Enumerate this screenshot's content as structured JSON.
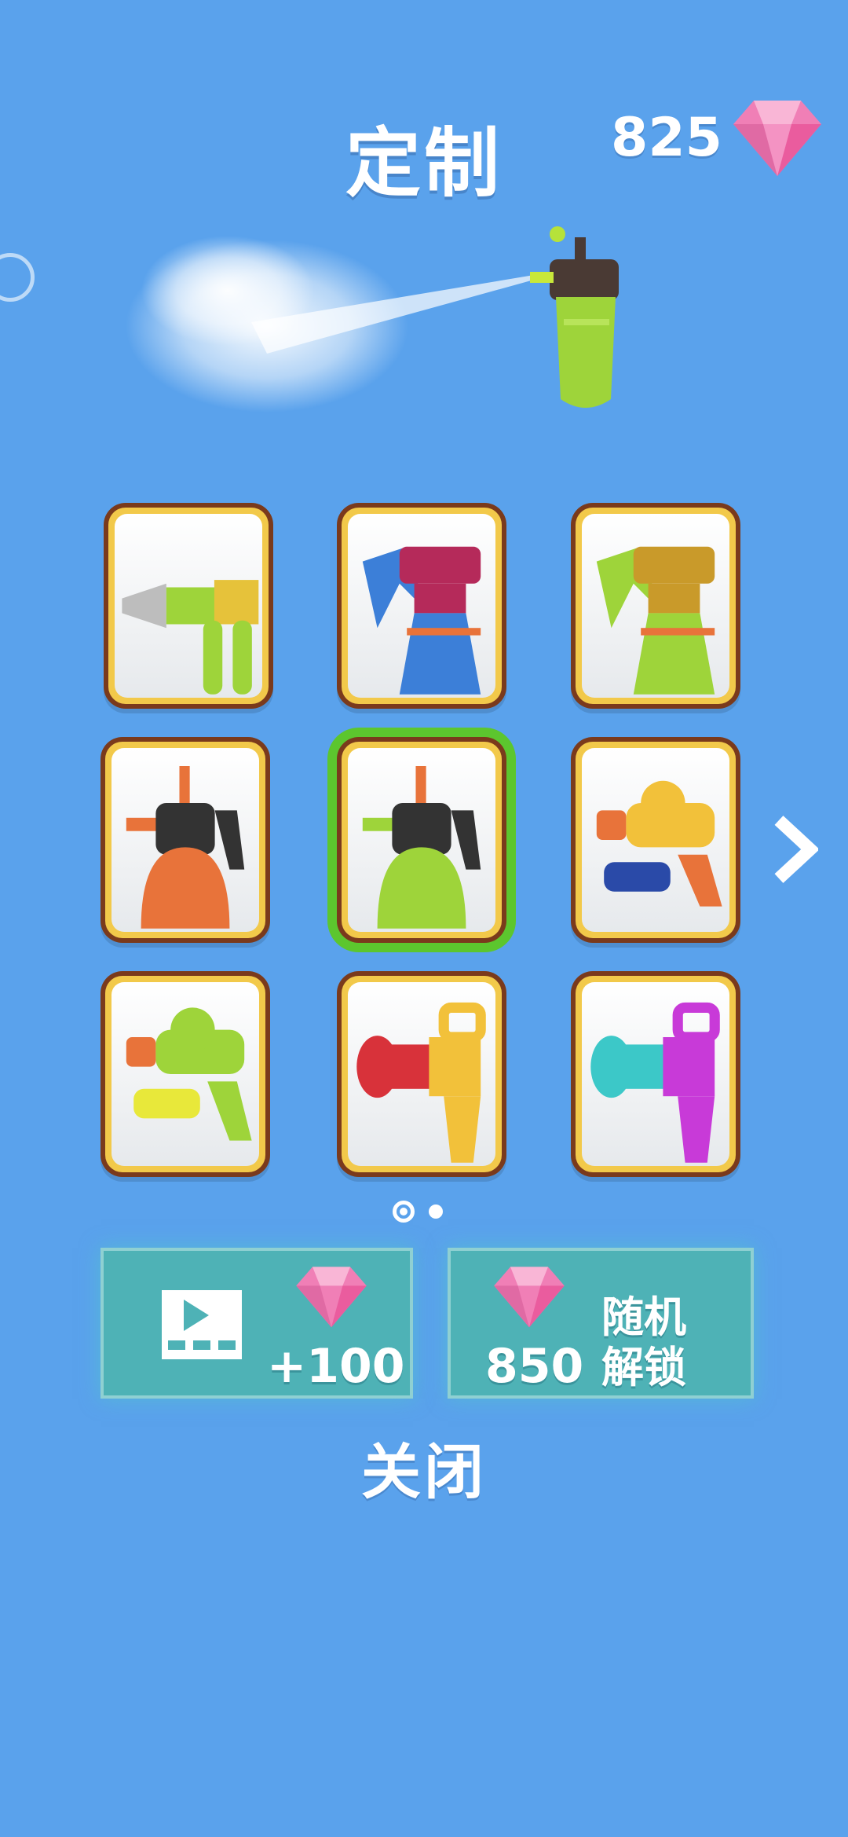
{
  "header": {
    "title": "定制",
    "gem_count": "825"
  },
  "items": [
    {
      "name": "nozzle-sprayer",
      "color": "#9ed43a",
      "selected": false
    },
    {
      "name": "trigger-spray-bottle",
      "color": "#3c7fd8",
      "selected": false
    },
    {
      "name": "trigger-spray-bottle",
      "color": "#9ed43a",
      "selected": false
    },
    {
      "name": "pump-sprayer",
      "color": "#e8733a",
      "selected": false
    },
    {
      "name": "pump-sprayer",
      "color": "#9ed43a",
      "selected": true
    },
    {
      "name": "water-gun",
      "color": "#f2c13a",
      "selected": false
    },
    {
      "name": "water-gun",
      "color": "#9ed43a",
      "selected": false
    },
    {
      "name": "blaster",
      "color": "#d8323a",
      "selected": false
    },
    {
      "name": "blaster",
      "color": "#3cc8c8",
      "selected": false
    }
  ],
  "buttons": {
    "video_reward": "+100",
    "random_unlock_price": "850",
    "random_unlock_line1": "随机",
    "random_unlock_line2": "解锁",
    "close": "关闭"
  },
  "pagination": {
    "current": 1,
    "total": 2
  }
}
